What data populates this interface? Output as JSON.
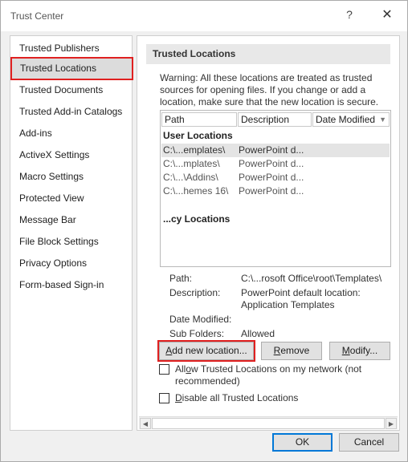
{
  "window": {
    "title": "Trust Center",
    "help_glyph": "?",
    "close_glyph": "✕"
  },
  "sidebar": {
    "items": [
      {
        "label": "Trusted Publishers"
      },
      {
        "label": "Trusted Locations",
        "selected": true
      },
      {
        "label": "Trusted Documents"
      },
      {
        "label": "Trusted Add-in Catalogs"
      },
      {
        "label": "Add-ins"
      },
      {
        "label": "ActiveX Settings"
      },
      {
        "label": "Macro Settings"
      },
      {
        "label": "Protected View"
      },
      {
        "label": "Message Bar"
      },
      {
        "label": "File Block Settings"
      },
      {
        "label": "Privacy Options"
      },
      {
        "label": "Form-based Sign-in"
      }
    ]
  },
  "main": {
    "section_title": "Trusted Locations",
    "warning": "Warning: All these locations are treated as trusted sources for opening files.  If you change or add a location, make sure that the new location is secure.",
    "table": {
      "columns": [
        "Path",
        "Description",
        "Date Modified"
      ],
      "sort_glyph": "▼",
      "user_group": "User Locations",
      "user_rows": [
        {
          "path": "C:\\...emplates\\",
          "description": "PowerPoint d...",
          "selected": true
        },
        {
          "path": "C:\\...mplates\\",
          "description": "PowerPoint d..."
        },
        {
          "path": "C:\\...\\Addins\\",
          "description": "PowerPoint d..."
        },
        {
          "path": "C:\\...hemes 16\\",
          "description": "PowerPoint d..."
        }
      ],
      "policy_group": "...cy Locations"
    },
    "details": {
      "path_label": "Path:",
      "path_value": "C:\\...rosoft Office\\root\\Templates\\",
      "description_label": "Description:",
      "description_line1": "PowerPoint default location:",
      "description_line2": "Application Templates",
      "date_label": "Date Modified:",
      "subfolders_label": "Sub Folders:",
      "subfolders_value": "Allowed"
    },
    "buttons": {
      "add_pre": "",
      "add_ul": "A",
      "add_post": "dd new location...",
      "remove_ul": "R",
      "remove_post": "emove",
      "modify_ul": "M",
      "modify_post": "odify..."
    },
    "checkboxes": {
      "network_pre": "All",
      "network_ul": "o",
      "network_post": "w Trusted Locations on my network (not",
      "network_line2": "recommended)",
      "disable_ul": "D",
      "disable_post": "isable all Trusted Locations"
    },
    "scroll": {
      "left_glyph": "◀",
      "right_glyph": "▶"
    }
  },
  "footer": {
    "ok_label": "OK",
    "cancel_label": "Cancel"
  }
}
